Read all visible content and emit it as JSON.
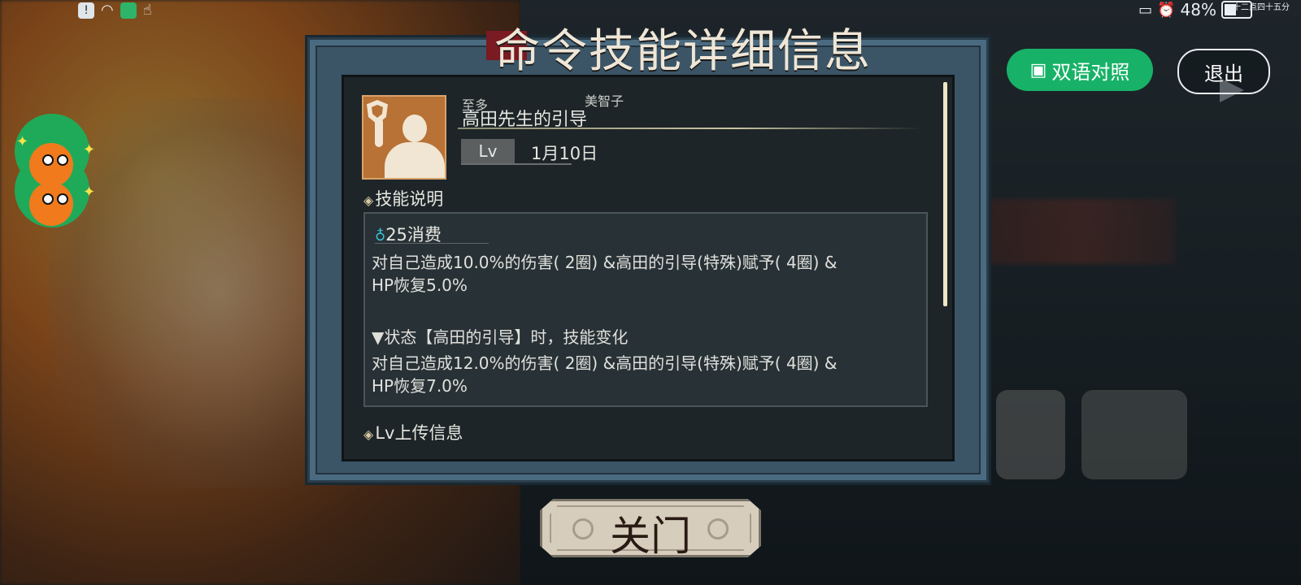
{
  "status_bar": {
    "battery": "48%",
    "time_small": "十二点四十五分"
  },
  "dialog": {
    "title": "命令技能详细信息",
    "furigana_left": "至多",
    "furigana_right": "美智子",
    "skill_name": "高田先生的引导",
    "lv_label": "Lv",
    "lv_value": "1月10日",
    "section_desc": "技能说明",
    "cost": "25消费",
    "line1": "对自己造成10.0%的伤害( 2圈) &高田的引导(特殊)赋予( 4圈) &",
    "line2": "HP恢复5.0%",
    "line3": "▼状态【高田的引导】时，技能变化",
    "line4": "对自己造成12.0%的伤害( 2圈) &高田的引导(特殊)赋予( 4圈) &",
    "line5": "HP恢复7.0%",
    "section_lv": "Lv上传信息",
    "close_label": "关门"
  },
  "top_buttons": {
    "bilingual": "双语对照",
    "exit": "退出"
  },
  "icons": {
    "section_marker": "diamond-icon",
    "cost": "water-drop-icon",
    "rank": "shield-icon",
    "bilingual": "translate-icon"
  },
  "colors": {
    "bilingual_green": "#17b267",
    "dialog_frame": "#4a6a80",
    "panel_bg": "#1d2528"
  }
}
